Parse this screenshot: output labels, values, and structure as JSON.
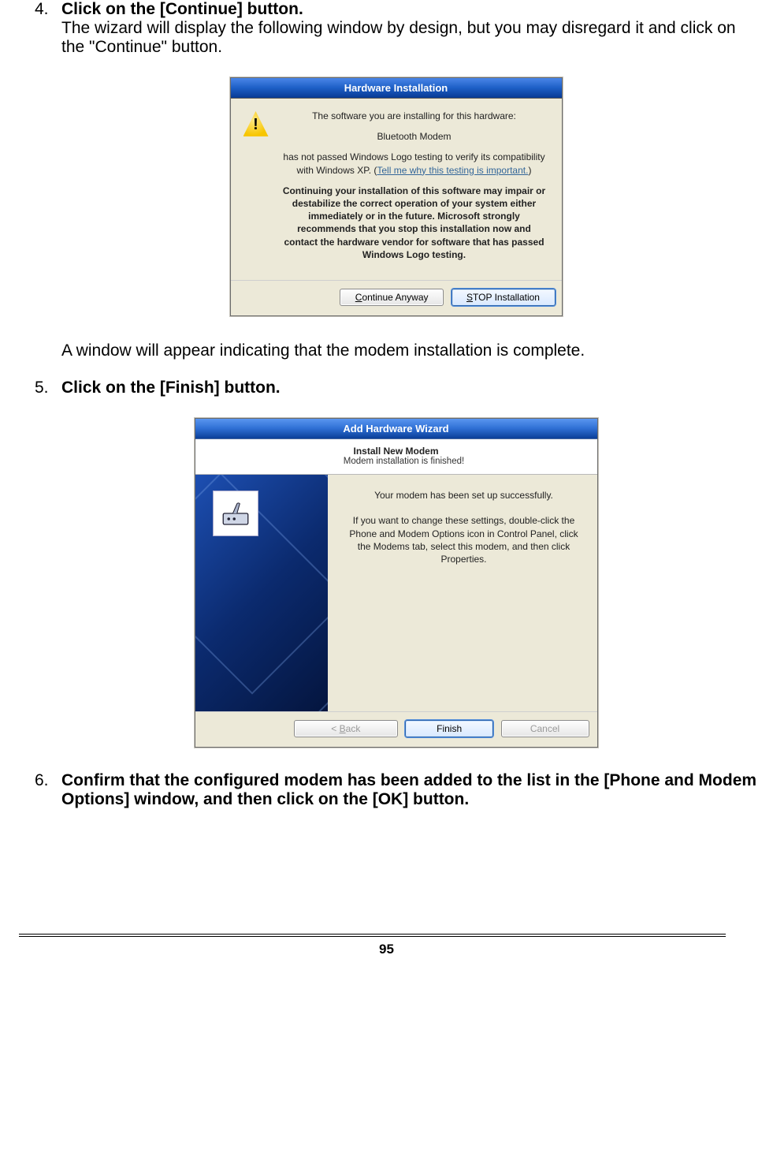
{
  "steps": {
    "s4_num": "4.",
    "s4_title": "Click on the [Continue] button.",
    "s4_body": "The wizard will display the following window by design, but you may disregard it and click on the \"Continue\" button.",
    "s4_after": "A window will appear indicating that the modem installation is complete.",
    "s5_num": "5.",
    "s5_title": "Click on the [Finish] button.",
    "s6_num": "6.",
    "s6_title": "Confirm that the configured modem has been added to the list in the [Phone and Modem Options] window, and then click on the [OK] button."
  },
  "dlg1": {
    "title": "Hardware Installation",
    "line1": "The software you are installing for this hardware:",
    "line2": "Bluetooth Modem",
    "line3a": "has not passed Windows Logo testing to verify its compatibility with Windows XP. (",
    "line3link": "Tell me why this testing is important.",
    "line3b": ")",
    "bold": "Continuing your installation of this software may impair or destabilize the correct operation of your system either immediately or in the future. Microsoft strongly recommends that you stop this installation now and contact the hardware vendor for software that has passed Windows Logo testing.",
    "btn_continue_pre": "C",
    "btn_continue_rest": "ontinue Anyway",
    "btn_stop_pre": "S",
    "btn_stop_rest": "TOP Installation"
  },
  "dlg2": {
    "title": "Add Hardware Wizard",
    "h1": "Install New Modem",
    "h2": "Modem installation is finished!",
    "p1": "Your modem has been set up successfully.",
    "p2": "If you want to change these settings, double-click the Phone and Modem Options icon in Control Panel, click the Modems tab, select this modem, and then click Properties.",
    "btn_back_pre": "< ",
    "btn_back_u": "B",
    "btn_back_rest": "ack",
    "btn_finish": "Finish",
    "btn_cancel": "Cancel"
  },
  "page_number": "95"
}
